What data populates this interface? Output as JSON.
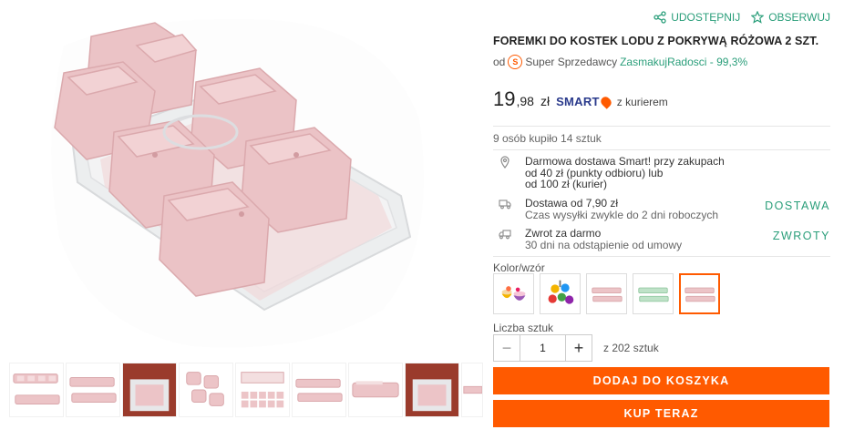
{
  "actions": {
    "share": "UDOSTĘPNIJ",
    "watch": "OBSERWUJ"
  },
  "product": {
    "title": "FOREMKI DO KOSTEK LODU Z POKRYWĄ RÓŻOWA 2 SZT."
  },
  "seller": {
    "prefix": "od",
    "badge": "S",
    "type": "Super Sprzedawcy",
    "name": "ZasmakujRadosci - 99,3%"
  },
  "price": {
    "integer": "19",
    "decimal": ",98",
    "currency": "zł",
    "smart": "SMART",
    "delivery": "z kurierem"
  },
  "bought": "9 osób kupiło 14 sztuk",
  "shipping": {
    "free": {
      "line1": "Darmowa dostawa Smart! przy zakupach",
      "line2": "od 40 zł (punkty odbioru) lub",
      "line3": "od 100 zł (kurier)"
    },
    "delivery": {
      "line1": "Dostawa od 7,90 zł",
      "line2": "Czas wysyłki zwykle do 2 dni roboczych",
      "link": "DOSTAWA"
    },
    "returns": {
      "line1": "Zwrot za darmo",
      "line2": "30 dni na odstąpienie od umowy",
      "link": "ZWROTY"
    }
  },
  "variants": {
    "label": "Kolor/wzór",
    "selected_index": 4
  },
  "quantity": {
    "label": "Liczba sztuk",
    "value": "1",
    "of": "z 202 sztuk",
    "minus": "−",
    "plus": "+"
  },
  "buttons": {
    "add_to_cart": "DODAJ DO KOSZYKA",
    "buy_now": "KUP TERAZ"
  },
  "colors": {
    "accent": "#ff5a00",
    "link": "#2a9e7a",
    "product_pink": "#ebc3c6"
  }
}
